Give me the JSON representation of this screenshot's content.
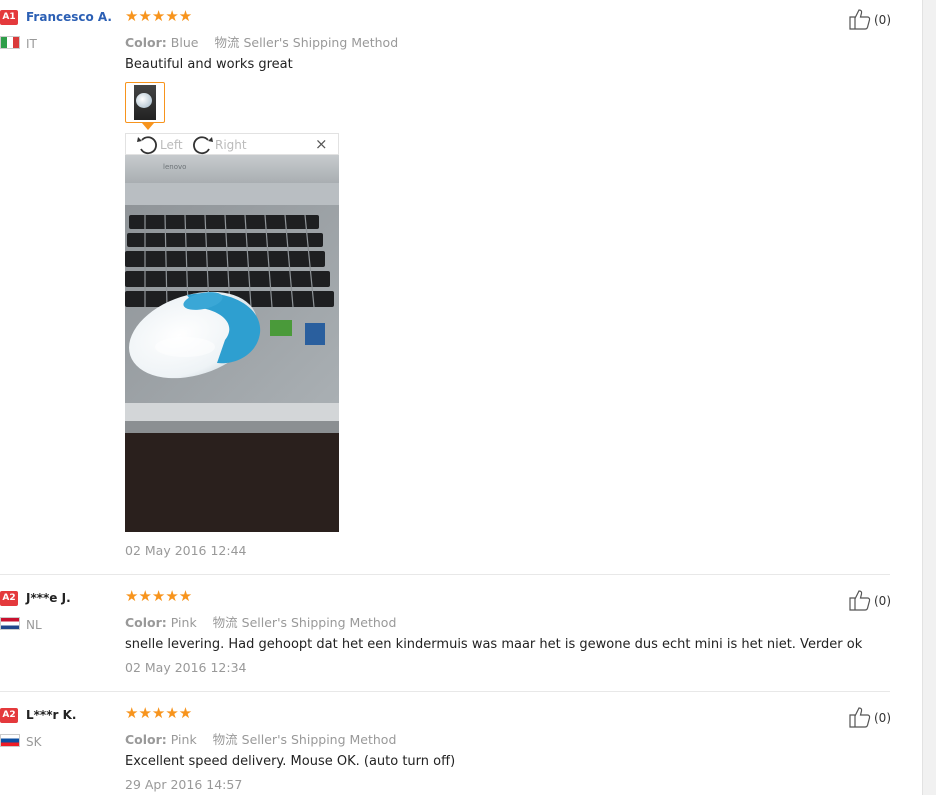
{
  "reviews": [
    {
      "level": "A1",
      "user": "Francesco A.",
      "country": "IT",
      "stars": "★★★★★",
      "color_label": "Color:",
      "color": "Blue",
      "logistics_label": "物流",
      "logistics": "Seller's Shipping Method",
      "text": "Beautiful and works great",
      "date": "02 May 2016 12:44",
      "helpful": "(0)"
    },
    {
      "level": "A2",
      "user": "J***e J.",
      "country": "NL",
      "stars": "★★★★★",
      "color_label": "Color:",
      "color": "Pink",
      "logistics_label": "物流",
      "logistics": "Seller's Shipping Method",
      "text": "snelle levering. Had gehoopt dat het een kindermuis was maar het is gewone dus echt mini is het niet. Verder ok",
      "date": "02 May 2016 12:34",
      "helpful": "(0)"
    },
    {
      "level": "A2",
      "user": "L***r K.",
      "country": "SK",
      "stars": "★★★★★",
      "color_label": "Color:",
      "color": "Pink",
      "logistics_label": "物流",
      "logistics": "Seller's Shipping Method",
      "text": "Excellent speed delivery. Mouse OK. (auto turn off)",
      "date": "29 Apr 2016 14:57",
      "helpful": "(0)"
    }
  ],
  "viewer": {
    "rotate_left": "Left",
    "rotate_right": "Right",
    "close": "×",
    "laptop_brand": "lenovo"
  },
  "colors": {
    "badge": "#e4393c",
    "star": "#f7941d",
    "username_link": "#2b5fb4",
    "muted": "#999999"
  },
  "icons": [
    "thumbs-up-icon",
    "rotate-left-icon",
    "rotate-right-icon",
    "close-icon",
    "flag-icon"
  ]
}
